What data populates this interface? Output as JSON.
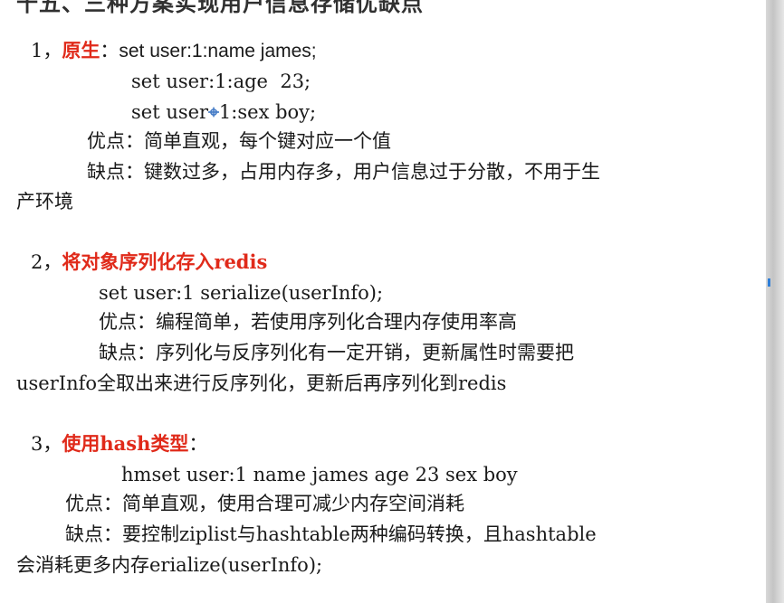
{
  "heading": "十五、三种方案实现用户信息存储优缺点",
  "s1": {
    "number": "1，",
    "title": "原生",
    "colon": "：",
    "cmd1": "set user:1:name james;",
    "cmd2": "set user:1:age  23;",
    "cmd3a": "set user",
    "cmd3b": "1:sex boy;",
    "pros": "优点：简单直观，每个键对应一个值",
    "cons1": "缺点：键数过多，占用内存多，用户信息过于分散，不用于生",
    "cons2": "产环境"
  },
  "s2": {
    "number": "2，",
    "title": "将对象序列化存入redis",
    "cmd": "set user:1 serialize(userInfo);",
    "pros": "优点：编程简单，若使用序列化合理内存使用率高",
    "cons1": "缺点：序列化与反序列化有一定开销，更新属性时需要把",
    "cons2": "userInfo全取出来进行反序列化，更新后再序列化到redis"
  },
  "s3": {
    "number": "3，",
    "title": "使用hash类型",
    "colon": "：",
    "cmd": "hmset user:1 name james age 23 sex boy",
    "pros": "优点：简单直观，使用合理可减少内存空间消耗",
    "cons1": "缺点：要控制ziplist与hashtable两种编码转换，且hashtable",
    "cons2": "会消耗更多内存erialize(userInfo);"
  }
}
